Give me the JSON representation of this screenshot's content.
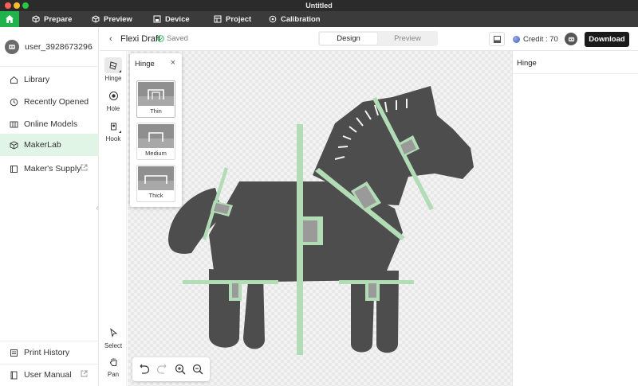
{
  "window": {
    "title": "Untitled"
  },
  "menubar": {
    "items": [
      {
        "label": "Prepare",
        "icon": "box-icon"
      },
      {
        "label": "Preview",
        "icon": "cube-icon"
      },
      {
        "label": "Device",
        "icon": "printer-icon"
      },
      {
        "label": "Project",
        "icon": "grid-icon"
      },
      {
        "label": "Calibration",
        "icon": "target-icon"
      }
    ]
  },
  "sidebar": {
    "user": "user_3928673296",
    "items": [
      {
        "label": "Library"
      },
      {
        "label": "Recently Opened"
      },
      {
        "label": "Online Models"
      },
      {
        "label": "MakerLab"
      },
      {
        "label": "Maker's Supply"
      }
    ],
    "bottom": [
      {
        "label": "Print History"
      },
      {
        "label": "User Manual"
      }
    ]
  },
  "header": {
    "title": "Flexi Draft",
    "saved": "Saved",
    "tabs": [
      {
        "label": "Design"
      },
      {
        "label": "Preview"
      }
    ],
    "credit": "Credit : 70",
    "download": "Download"
  },
  "tools": {
    "hinge": "Hinge",
    "hole": "Hole",
    "hook": "Hook",
    "select": "Select",
    "pan": "Pan"
  },
  "hinge_popup": {
    "title": "Hinge",
    "options": [
      {
        "label": "Thin"
      },
      {
        "label": "Medium"
      },
      {
        "label": "Thick"
      }
    ]
  },
  "right_panel": {
    "title": "Hinge"
  },
  "colors": {
    "accent": "#22b24c",
    "hinge": "#b2dcb6",
    "model": "#4d4d4d",
    "active_nav": "#e1f5e6"
  }
}
